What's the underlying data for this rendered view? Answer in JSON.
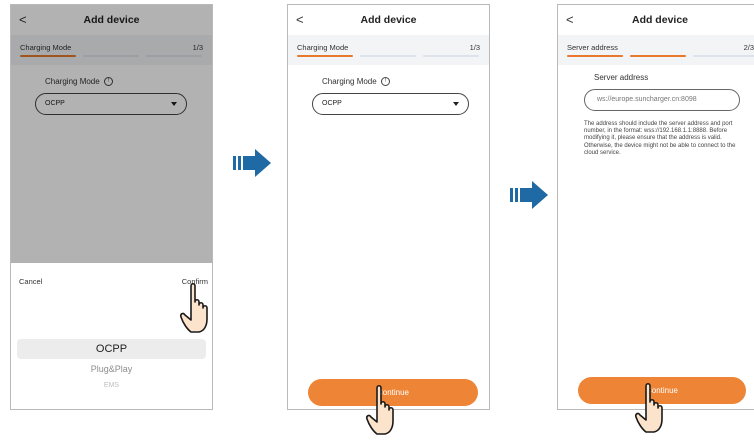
{
  "screens": [
    {
      "title": "Add device",
      "back_icon": "chevron-left-icon",
      "step_label": "Charging Mode",
      "step_count": "1/3",
      "field_label": "Charging Mode",
      "select_value": "OCPP",
      "picker": {
        "cancel": "Cancel",
        "confirm": "Confirm",
        "options": [
          "OCPP",
          "Plug&Play",
          "EMS"
        ],
        "selected": "OCPP"
      }
    },
    {
      "title": "Add device",
      "back_icon": "chevron-left-icon",
      "step_label": "Charging Mode",
      "step_count": "1/3",
      "field_label": "Charging Mode",
      "select_value": "OCPP",
      "continue": "Continue"
    },
    {
      "title": "Add device",
      "back_icon": "chevron-left-icon",
      "step_label": "Server address",
      "step_count": "2/3",
      "field_label": "Server address",
      "placeholder": "ws://europe.suncharger.cn:8098",
      "hint": "The address should include the server address and port number, in the format: wss://192.168.1.1:8888. Before modifying it, please ensure that the address is valid. Otherwise, the device might not be able to connect to the cloud service.",
      "continue": "Continue"
    }
  ],
  "colors": {
    "accent": "#ee8435",
    "arrow": "#1f6aa5",
    "progress_inactive": "#dde3ec"
  }
}
